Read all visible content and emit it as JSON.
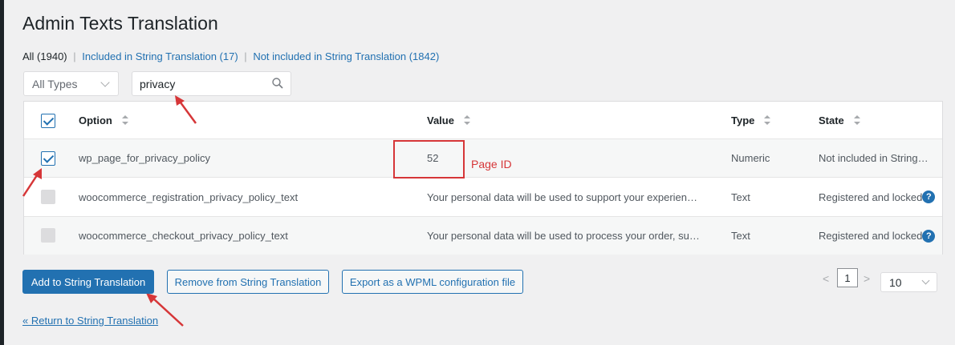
{
  "page": {
    "title": "Admin Texts Translation"
  },
  "filters": {
    "all": "All (1940)",
    "included": "Included in String Translation (17)",
    "not_included": "Not included in String Translation (1842)",
    "separator": "|"
  },
  "controls": {
    "type_select": "All Types",
    "search_value": "privacy"
  },
  "table": {
    "headers": {
      "option": "Option",
      "value": "Value",
      "type": "Type",
      "state": "State"
    },
    "rows": [
      {
        "option": "wp_page_for_privacy_policy",
        "value": "52",
        "type": "Numeric",
        "state": "Not included in String…",
        "checked": true
      },
      {
        "option": "woocommerce_registration_privacy_policy_text",
        "value": "Your personal data will be used to support your experien…",
        "type": "Text",
        "state": "Registered and locked",
        "checked": false
      },
      {
        "option": "woocommerce_checkout_privacy_policy_text",
        "value": "Your personal data will be used to process your order, su…",
        "type": "Text",
        "state": "Registered and locked",
        "checked": false
      }
    ]
  },
  "annotations": {
    "page_id_label": "Page ID",
    "highlight_color": "#d63638"
  },
  "actions": {
    "add": "Add to String Translation",
    "remove": "Remove from String Translation",
    "export": "Export as a WPML configuration file"
  },
  "pagination": {
    "prev": "<",
    "current_page": "1",
    "next": ">",
    "per_page": "10"
  },
  "footer": {
    "return_link": "« Return to String Translation"
  },
  "help_glyph": "?",
  "colors": {
    "accent": "#2271b1",
    "background": "#f0f0f1"
  }
}
